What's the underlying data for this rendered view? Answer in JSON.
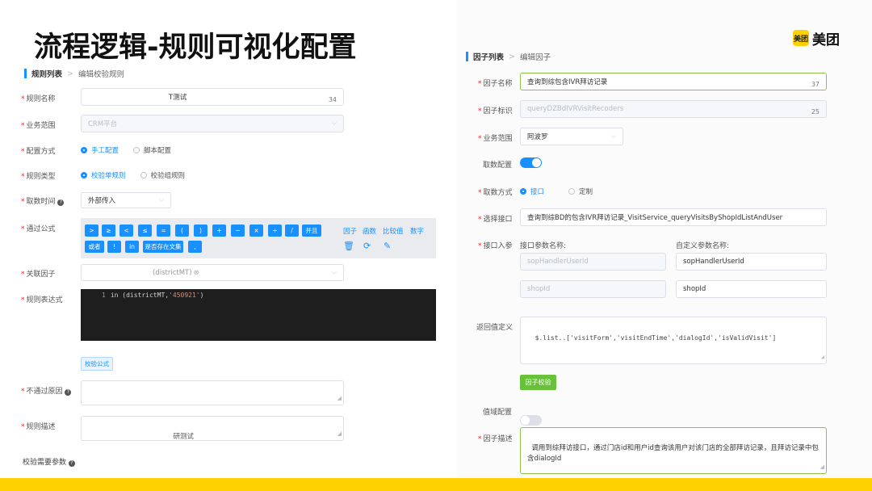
{
  "slide": {
    "title": "流程逻辑-规则可视化配置",
    "logo_mark": "美团",
    "logo_text": "美团"
  },
  "left": {
    "breadcrumb": {
      "current": "规则列表",
      "separator": ">",
      "sub": "编辑校验规则"
    },
    "rule_name": {
      "label": "规则名称",
      "value": "T测试",
      "count": "34"
    },
    "biz_scope": {
      "label": "业务范围",
      "value": "CRM平台"
    },
    "config_mode": {
      "label": "配置方式",
      "options": [
        "手工配置",
        "脚本配置"
      ],
      "selected": "手工配置"
    },
    "rule_type": {
      "label": "规则类型",
      "options": [
        "校验单规则",
        "校验组规则"
      ],
      "selected": "校验单规则"
    },
    "fetch_time": {
      "label": "取数时间",
      "help_icon": "question-circle-icon",
      "value": "外部传入"
    },
    "formula": {
      "label": "通过公式",
      "symbols_row1": [
        ">",
        "≥",
        "<",
        "≤",
        "=",
        "(",
        ")",
        "+",
        "−",
        "×",
        "÷",
        "/",
        "并且"
      ],
      "symbols_row2": [
        "或者",
        "!",
        "in",
        "是否存在文集",
        ","
      ],
      "links": [
        "因子",
        "函数",
        "比较值",
        "数字"
      ],
      "action_icons": [
        "trash-icon",
        "refresh-icon",
        "edit-icon"
      ]
    },
    "linked_factor": {
      "label": "关联因子",
      "tag": "(districtMT)"
    },
    "rule_expr": {
      "label": "规则表达式",
      "line_no": "1",
      "code_kw": "in (districtMT,",
      "code_str": "'450921'",
      "code_end": ")"
    },
    "check_formula_btn": "校验公式",
    "fail_reason": {
      "label": "不通过原因",
      "value": ""
    },
    "rule_desc": {
      "label": "规则描述",
      "value": "研测试"
    },
    "params_section": "校验需要参数"
  },
  "right": {
    "breadcrumb": {
      "current": "因子列表",
      "separator": ">",
      "sub": "编辑因子"
    },
    "factor_name": {
      "label": "因子名称",
      "value": "查询到综包含IVR拜访记录",
      "count": "37"
    },
    "factor_id": {
      "label": "因子标识",
      "value": "queryDZBdIVRVisitRecoders",
      "count": "25"
    },
    "biz_scope": {
      "label": "业务范围",
      "value": "阿波罗"
    },
    "fetch_config": {
      "label": "取数配置",
      "on": true
    },
    "fetch_mode": {
      "label": "取数方式",
      "options": [
        "接口",
        "定制"
      ],
      "selected": "接口"
    },
    "select_api": {
      "label": "选择接口",
      "value": "查询到综BD的包含IVR拜访记录_VisitService_queryVisitsByShopIdListAndUser"
    },
    "api_params": {
      "label": "接口入参",
      "col1_header": "接口参数名称:",
      "col2_header": "自定义参数名称:",
      "rows": [
        {
          "param": "sopHandlerUserId",
          "custom": "sopHandlerUserId"
        },
        {
          "param": "shopId",
          "custom": "shopId"
        }
      ]
    },
    "return_def": {
      "label": "返回值定义",
      "value": "$.list..['visitForm','visitEndTime','dialogId','isValidVisit']"
    },
    "check_factor_btn": "因子校验",
    "range_config": {
      "label": "值域配置",
      "on": false
    },
    "factor_desc": {
      "label": "因子描述",
      "value": "调用到综拜访接口，通过门店id和用户id查询该用户对该门店的全部拜访记录，且拜访记录中包含dialogId"
    }
  }
}
